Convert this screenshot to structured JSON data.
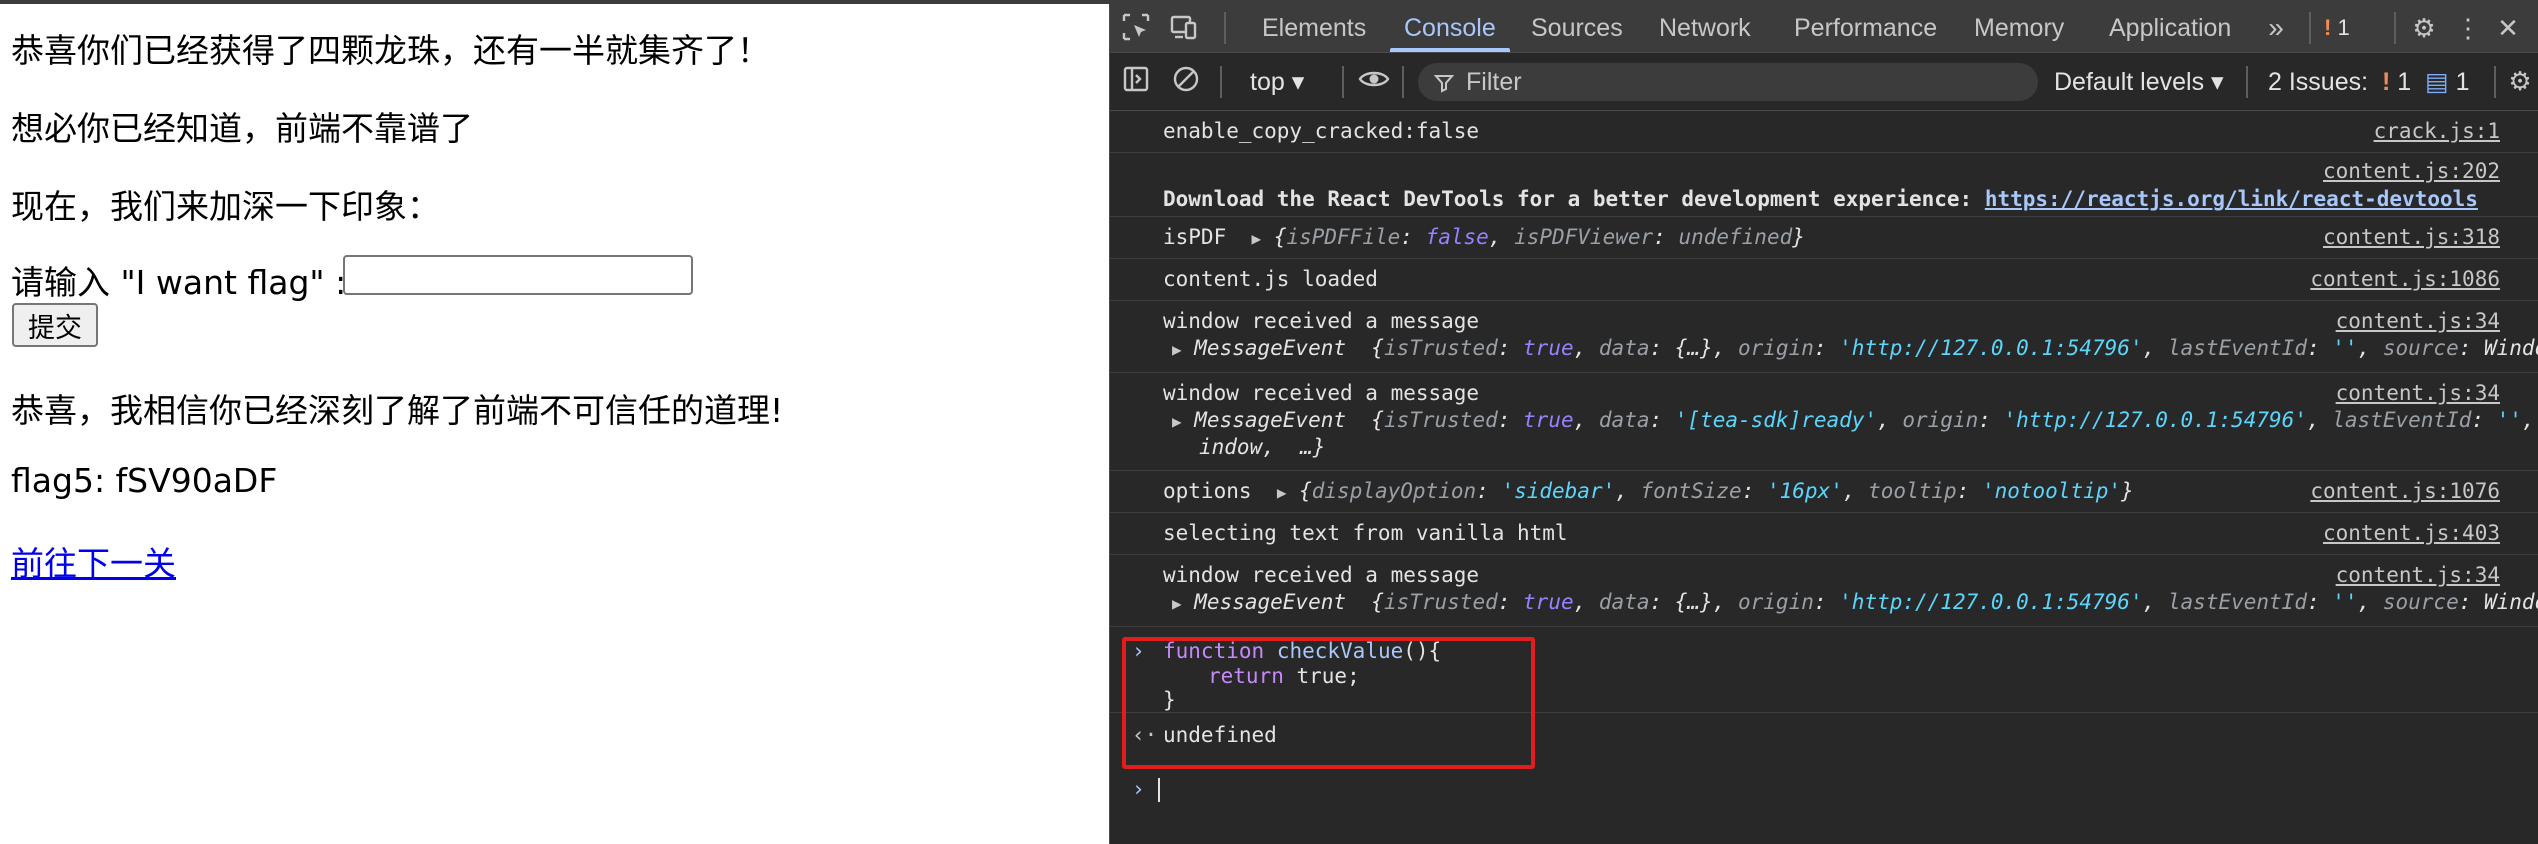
{
  "page": {
    "line1": "恭喜你们已经获得了四颗龙珠，还有一半就集齐了！",
    "line2": "想必你已经知道，前端不靠谱了",
    "line3": "现在，我们来加深一下印象：",
    "input_label": "请输入 \"I want flag\" :",
    "input_value": "",
    "submit_label": "提交",
    "line4": "恭喜，我相信你已经深刻了解了前端不可信任的道理!",
    "flag": "flag5: fSV90aDF",
    "next_link": "前往下一关"
  },
  "devtools": {
    "tabs": [
      "Elements",
      "Console",
      "Sources",
      "Network",
      "Performance",
      "Memory",
      "Application"
    ],
    "active_tab": "Console",
    "issue_count_top": "1",
    "context": "top ▾",
    "filter_placeholder": "Filter",
    "levels": "Default levels ▾",
    "issues_label": "2 Issues:",
    "issues_warn": "1",
    "issues_info": "1",
    "messages": [
      {
        "text": "enable_copy_cracked:false",
        "src": "crack.js:1"
      },
      {
        "src": "content.js:202",
        "text": "Download the React DevTools for a better development experience: ",
        "url": "https://reactjs.org/link/react-devtools"
      },
      {
        "text": "isPDF",
        "src": "content.js:318"
      },
      {
        "text": "content.js loaded",
        "src": "content.js:1086"
      },
      {
        "text": "window received a message",
        "src": "content.js:34"
      },
      {
        "text": "window received a message",
        "src": "content.js:34"
      },
      {
        "text": "options",
        "src": "content.js:1076"
      },
      {
        "text": "selecting text from vanilla html",
        "src": "content.js:403"
      },
      {
        "text": "window received a message",
        "src": "content.js:34"
      }
    ],
    "input_code": {
      "line1_kw": "function",
      "line1_fn": "checkValue",
      "line1_rest": "(){",
      "line2_kw": "return",
      "line2_rest": " true;",
      "line3": "}"
    },
    "result": "undefined"
  }
}
